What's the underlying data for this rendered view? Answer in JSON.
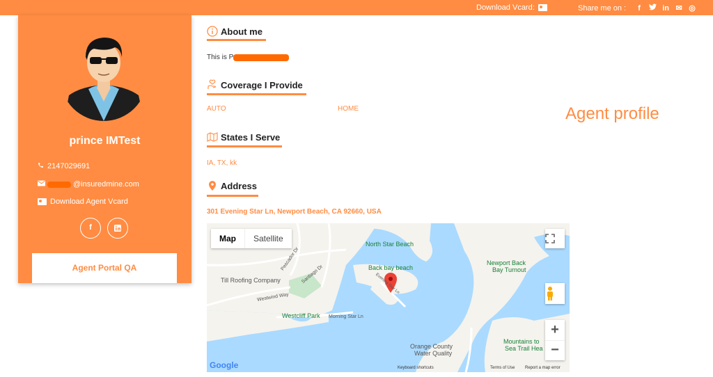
{
  "topbar": {
    "download_vcard": "Download Vcard:",
    "share_label": "Share me on :",
    "share_icons": [
      {
        "name": "facebook-icon",
        "glyph": "f"
      },
      {
        "name": "twitter-icon",
        "glyph": "t"
      },
      {
        "name": "linkedin-icon",
        "glyph": "in"
      },
      {
        "name": "email-icon",
        "glyph": "✉"
      },
      {
        "name": "whatsapp-icon",
        "glyph": "◎"
      }
    ]
  },
  "agent": {
    "name": "prince IMTest",
    "phone": "2147029691",
    "email_visible": "@insuredmine.com",
    "download_vcard": "Download Agent Vcard",
    "portal_button": "Agent Portal QA"
  },
  "sections": {
    "about_title": "About me",
    "about_text": "This is P",
    "coverage_title": "Coverage I Provide",
    "coverage_items": [
      "AUTO",
      "HOME"
    ],
    "states_title": "States I Serve",
    "states_text": "IA, TX, kk",
    "address_title": "Address",
    "address_text": "301 Evening Star Ln, Newport Beach, CA 92660, USA"
  },
  "watermark": "Agent profile",
  "map": {
    "tab_map": "Map",
    "tab_satellite": "Satellite",
    "labels": {
      "north_star": "North Star Beach",
      "back_bay_beach": "Back bay beach",
      "newport_turnout_1": "Newport Back",
      "newport_turnout_2": "Bay Turnout",
      "till_roofing": "Till Roofing Company",
      "westcliff_park": "Westcliff Park",
      "morning_star": "Morning Star Ln",
      "westwind": "Westwind Way",
      "mountains_1": "Mountains to",
      "mountains_2": "Sea Trail Hea",
      "orange_county_1": "Orange County",
      "orange_county_2": "Water Quality",
      "santiago": "Santiago Dr",
      "pescador": "Pescador Dr",
      "evening_star": "Evening Star Ln"
    },
    "footer": {
      "google": "Google",
      "shortcuts": "Keyboard shortcuts",
      "terms": "Terms of Use",
      "report": "Report a map error"
    },
    "zoom_in": "+",
    "zoom_out": "−"
  },
  "colors": {
    "accent": "#ff8c42",
    "redaction": "#ff6a00",
    "water": "#aadaff",
    "land": "#f5f3ee",
    "marker": "#ea4335"
  }
}
